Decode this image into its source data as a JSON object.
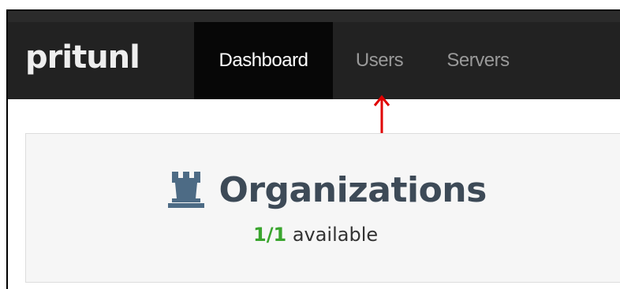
{
  "brand": {
    "name": "pritunl"
  },
  "nav": {
    "items": [
      {
        "label": "Dashboard",
        "active": true
      },
      {
        "label": "Users",
        "active": false
      },
      {
        "label": "Servers",
        "active": false
      }
    ]
  },
  "organizations": {
    "title": "Organizations",
    "icon": "tower-icon",
    "count": "1/1",
    "status_text": "available"
  },
  "colors": {
    "navbar": "#222222",
    "active_nav": "#070707",
    "title": "#3d4a57",
    "icon": "#4d6b85",
    "count": "#3aa52e",
    "annotation_arrow": "#e00000"
  }
}
